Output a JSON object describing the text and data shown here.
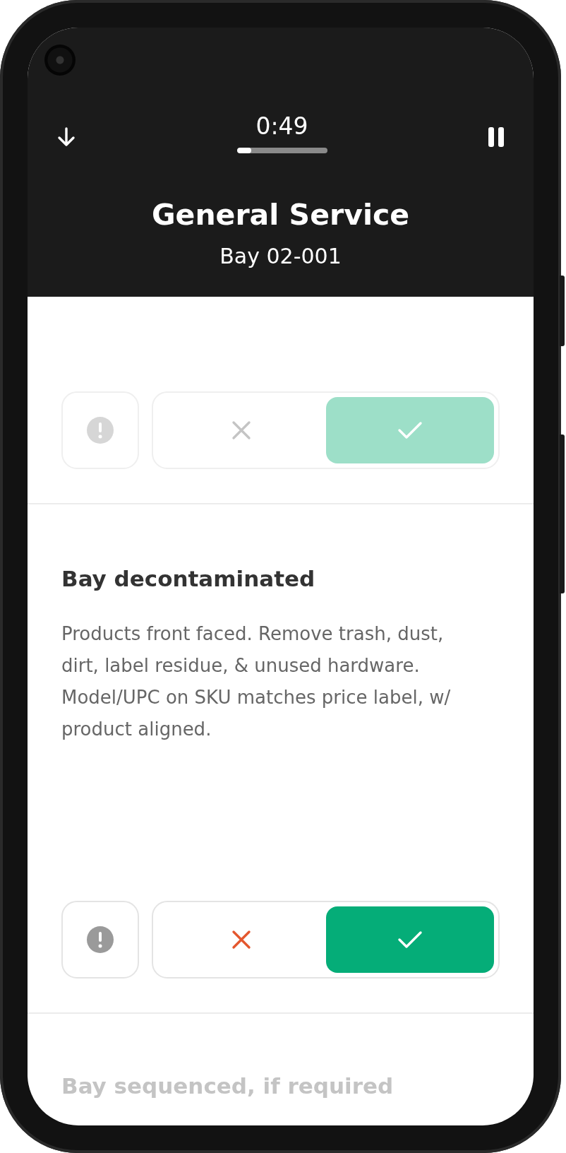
{
  "header": {
    "time": "0:49",
    "level": 0.16,
    "title": "General Service",
    "subtitle": "Bay 02-001"
  },
  "checklist": [
    {
      "dimmed": true,
      "passed": true,
      "failed": false
    },
    {
      "title": "Bay decontaminated",
      "description": "Products front faced. Remove trash, dust, dirt, label residue, & unused hardware. Model/UPC on SKU matches price label, w/ product aligned.",
      "dimmed": false,
      "passed": true,
      "failed": false
    },
    {
      "title": "Bay sequenced, if required",
      "dimmed": true
    }
  ]
}
